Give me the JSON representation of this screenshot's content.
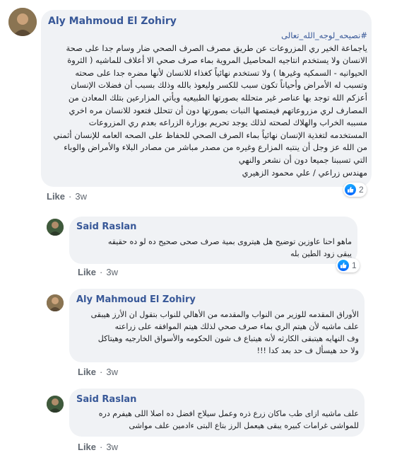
{
  "comments": [
    {
      "author": "Aly Mahmoud El Zohiry",
      "hashtag_line": "#نصيحه_لوجه_الله_تعالى",
      "lines": [
        "ياجماعة الخير ري المزروعات عن طريق مصرف الصرف الصحي ضار وسام جدا على صحة",
        "الانسان ولا يستخدم انتاجيه المحاصيل المروية بماء صرف صحي الا أعلاف للماشيه ( الثروة",
        "الحيوانيه - السمكيه وغيرها ) ولا تستخدم نهائياً كغذاء للانسان لأنها مضره جدا على صحته",
        "وتسبب له الأمراض وأحياناً تكون سبب للكسر وليعوذ بالله وذلك بسبب أن فضلات الإنسان",
        "أعزكم الله توجد بها عناصر غير متحلله بصورتها الطبيعيه ويأتي المزارعين بتلك المعادن من",
        "المصارف لري مزروعاتهم فيمتصها النبات بصورتها دون أن تتحلل فتعود للانسان مره اخري",
        "مسببه الخراب والهلاك لصحته لذلك يوجد تحريم بوزارة الزراعه بعدم ري المزروعات",
        "المستخدمه لتغذية الإنسان نهائياً بماء الصرف الصحي للحفاظ على الصحه العامه للإنسان أثمني",
        "من الله عز وجل أن ينتبه المزارع وغيره من مصدر مباشر من مصادر البلاء والأمراض والوباء",
        "التي تسببنا جميعا دون أن نشعر والنهي",
        "مهندس زراعي / علي محمود الزهيري"
      ],
      "like_label": "Like",
      "time": "3w",
      "reaction_count": "2"
    },
    {
      "author": "Said Raslan",
      "lines": [
        "ماهو احنا عاوزين توضيح هل هيتروى بمية صرف صحى صحيح ده لو ده حقيقه",
        "يبقى زود الطين بله"
      ],
      "like_label": "Like",
      "time": "3w",
      "reaction_count": "1"
    },
    {
      "author": "Aly Mahmoud El Zohiry",
      "lines": [
        "الأوراق المقدمه للوزير من النواب والمقدمه من الأهالي للنواب بتقول ان الأرز هيبقى",
        "علف ماشيه لأن هيتم الري بماء صرف صحي لذلك هيتم الموافقه على زراعته",
        "وف النهايه هيتبقى الكارثه لأنه هيتباع ف شون الحكومه والأسواق الخارجيه وهيتاكل",
        "ولا حد هيسأل ف حد بعد كدا !!!"
      ],
      "hashtags": [
        "#علف_ماشيه",
        "#بماء_صرف_صحي"
      ],
      "like_label": "Like",
      "time": "3w"
    },
    {
      "author": "Said Raslan",
      "lines": [
        "علف ماشيه ازاى طب ماكان زرع ذره وعمل سيلاج افضل ده اصلا اللى هيفرم دره",
        "للمواشى غرامات كبيره يبقى هيعمل الرز بتاع البتى ءادمين علف مواشى"
      ],
      "like_label": "Like",
      "time": "3w"
    }
  ],
  "colors": {
    "author_link": "#385898",
    "bubble_bg": "#f0f2f5",
    "meta_text": "#606770",
    "like_badge": "#0866ff"
  },
  "icons": [
    "avatar-photo",
    "thumbs-up-icon"
  ]
}
